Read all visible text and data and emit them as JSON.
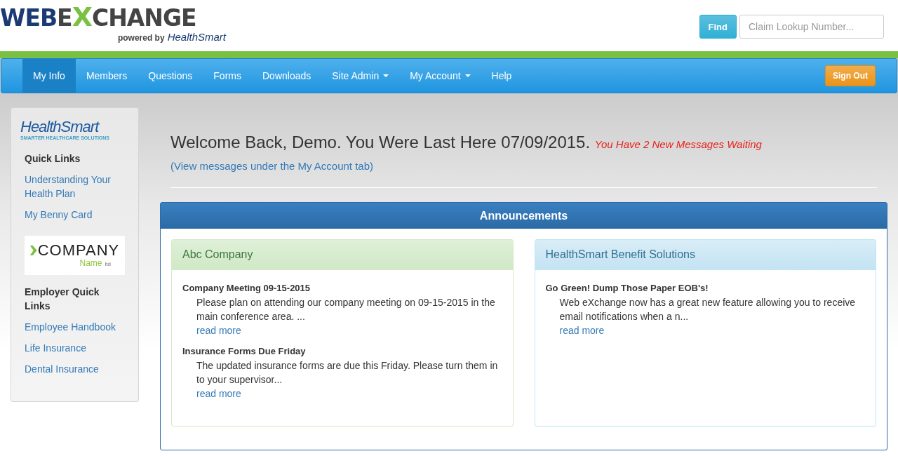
{
  "logo": {
    "word_1": "WEB",
    "word_2_start": "E",
    "word_2_x": "X",
    "word_2_end": "CHANGE",
    "tagline": "powered by",
    "brand": "HealthSmart"
  },
  "search": {
    "button": "Find",
    "placeholder": "Claim Lookup Number..."
  },
  "nav": {
    "items": [
      {
        "label": "My Info",
        "selected": true,
        "dropdown": false
      },
      {
        "label": "Members",
        "selected": false,
        "dropdown": false
      },
      {
        "label": "Questions",
        "selected": false,
        "dropdown": false
      },
      {
        "label": "Forms",
        "selected": false,
        "dropdown": false
      },
      {
        "label": "Downloads",
        "selected": false,
        "dropdown": false
      },
      {
        "label": "Site Admin",
        "selected": false,
        "dropdown": true
      },
      {
        "label": "My Account",
        "selected": false,
        "dropdown": true
      },
      {
        "label": "Help",
        "selected": false,
        "dropdown": false
      }
    ],
    "sign_out": "Sign Out"
  },
  "sidebar": {
    "brand_logo": {
      "name": "HealthSmart",
      "tagline": "SMARTER HEALTHCARE SOLUTIONS"
    },
    "sections": [
      {
        "title": "Quick Links",
        "links": [
          "Understanding Your Health Plan",
          "My Benny Card"
        ]
      },
      {
        "company_logo": {
          "word": "COMPANY",
          "sub": "Name",
          "mark": "ltd"
        },
        "title": "Employer Quick Links",
        "links": [
          "Employee Handbook",
          "Life Insurance",
          "Dental Insurance"
        ]
      }
    ]
  },
  "welcome": {
    "text": "Welcome Back, Demo. You Were Last Here 07/09/2015.",
    "alert": "You Have 2 New Messages Waiting",
    "link": "(View messages under the My Account tab)"
  },
  "announcements": {
    "title": "Announcements",
    "panels": [
      {
        "kind": "company",
        "title": "Abc Company",
        "items": [
          {
            "title": "Company Meeting 09-15-2015",
            "body": "Please plan on attending our company meeting on 09-15-2015 in the main conference area. ...",
            "link": "read more"
          },
          {
            "title": "Insurance Forms Due Friday",
            "body": "The updated insurance forms are due this Friday.  Please turn them in to your supervisor...",
            "link": "read more"
          }
        ]
      },
      {
        "kind": "provider",
        "title": "HealthSmart Benefit Solutions",
        "items": [
          {
            "title": "Go Green! Dump Those Paper EOB's!",
            "body": "Web eXchange now has a great new feature allowing you to receive email notifications when a n...",
            "link": "read more"
          }
        ]
      }
    ]
  }
}
